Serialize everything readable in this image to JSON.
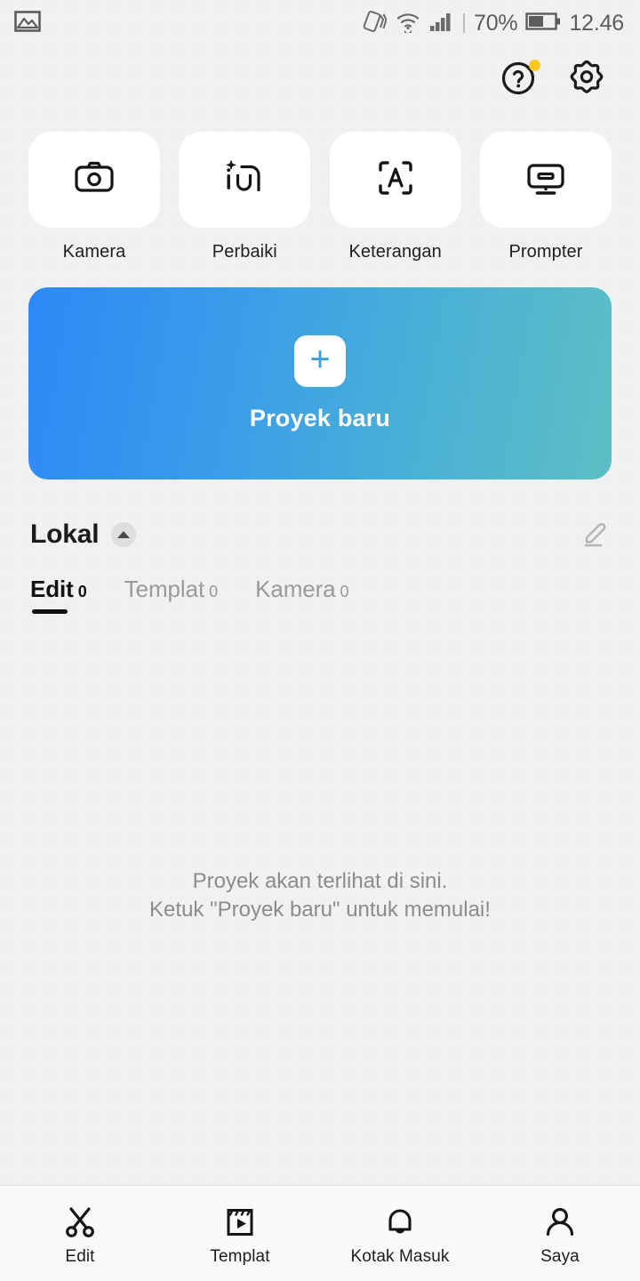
{
  "status_bar": {
    "left_icon": "image-icon",
    "vibrate_icon": "vibrate-icon",
    "wifi_icon": "wifi-icon",
    "signal_icon": "signal-bars-icon",
    "battery_percent": "70%",
    "battery_icon": "battery-icon",
    "time": "12.46"
  },
  "header": {
    "help_icon": "help-circle-icon",
    "help_badge": true,
    "settings_icon": "gear-icon"
  },
  "quick_tiles": [
    {
      "icon": "camera-icon",
      "label": "Kamera"
    },
    {
      "icon": "enhance-icon",
      "label": "Perbaiki"
    },
    {
      "icon": "scan-text-icon",
      "label": "Keterangan"
    },
    {
      "icon": "monitor-icon",
      "label": "Prompter"
    }
  ],
  "banner": {
    "plus_icon": "plus-icon",
    "label": "Proyek baru",
    "gradient_from": "#2e88f6",
    "gradient_to": "#5cbec3"
  },
  "section": {
    "title": "Lokal",
    "collapse_icon": "chevron-up-icon",
    "edit_icon": "pencil-icon"
  },
  "tabs": [
    {
      "label": "Edit",
      "count": "0",
      "active": true
    },
    {
      "label": "Templat",
      "count": "0",
      "active": false
    },
    {
      "label": "Kamera",
      "count": "0",
      "active": false
    }
  ],
  "empty_state": {
    "line1": "Proyek akan terlihat di sini.",
    "line2": "Ketuk \"Proyek baru\" untuk memulai!"
  },
  "bottom_nav": [
    {
      "icon": "scissors-icon",
      "label": "Edit"
    },
    {
      "icon": "template-icon",
      "label": "Templat"
    },
    {
      "icon": "bell-icon",
      "label": "Kotak Masuk"
    },
    {
      "icon": "person-icon",
      "label": "Saya"
    }
  ]
}
